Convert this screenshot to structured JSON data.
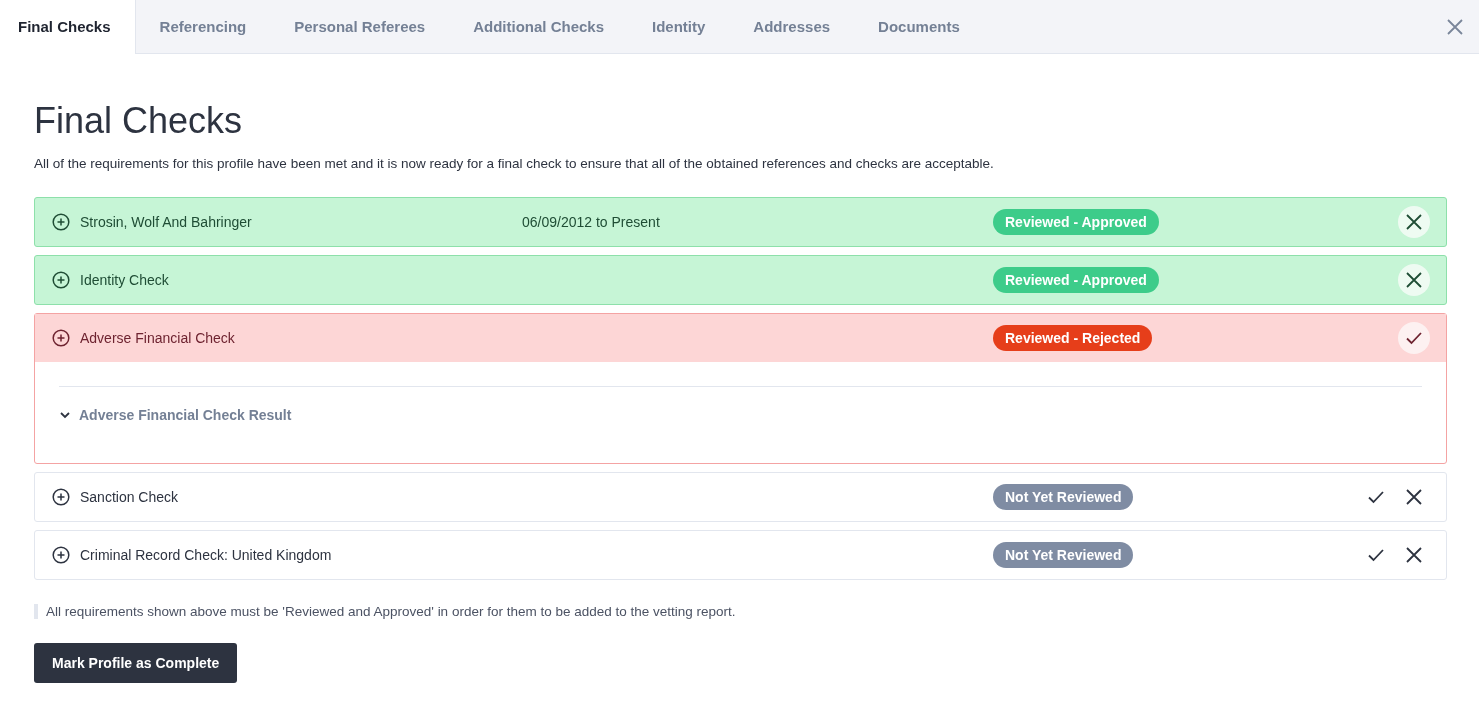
{
  "tabs": [
    {
      "label": "Final Checks",
      "selected": true
    },
    {
      "label": "Referencing",
      "selected": false
    },
    {
      "label": "Personal Referees",
      "selected": false
    },
    {
      "label": "Additional Checks",
      "selected": false
    },
    {
      "label": "Identity",
      "selected": false
    },
    {
      "label": "Addresses",
      "selected": false
    },
    {
      "label": "Documents",
      "selected": false
    }
  ],
  "title": "Final Checks",
  "intro": "All of the requirements for this profile have been met and it is now ready for a final check to ensure that all of the obtained references and checks are acceptable.",
  "checks": [
    {
      "name": "Strosin, Wolf And Bahringer",
      "dates": "06/09/2012 to Present",
      "kind": "approved",
      "badge": "Reviewed - Approved"
    },
    {
      "name": "Identity Check",
      "kind": "approved",
      "badge": "Reviewed - Approved"
    },
    {
      "name": "Adverse Financial Check",
      "kind": "rejected",
      "badge": "Reviewed - Rejected",
      "section": "Adverse Financial Check Result"
    },
    {
      "name": "Sanction Check",
      "kind": "pending",
      "badge": "Not Yet Reviewed"
    },
    {
      "name": "Criminal Record Check: United Kingdom",
      "kind": "pending",
      "badge": "Not Yet Reviewed"
    }
  ],
  "note": "All requirements shown above must be 'Reviewed and Approved' in order for them to be added to the vetting report.",
  "button": "Mark Profile as Complete"
}
